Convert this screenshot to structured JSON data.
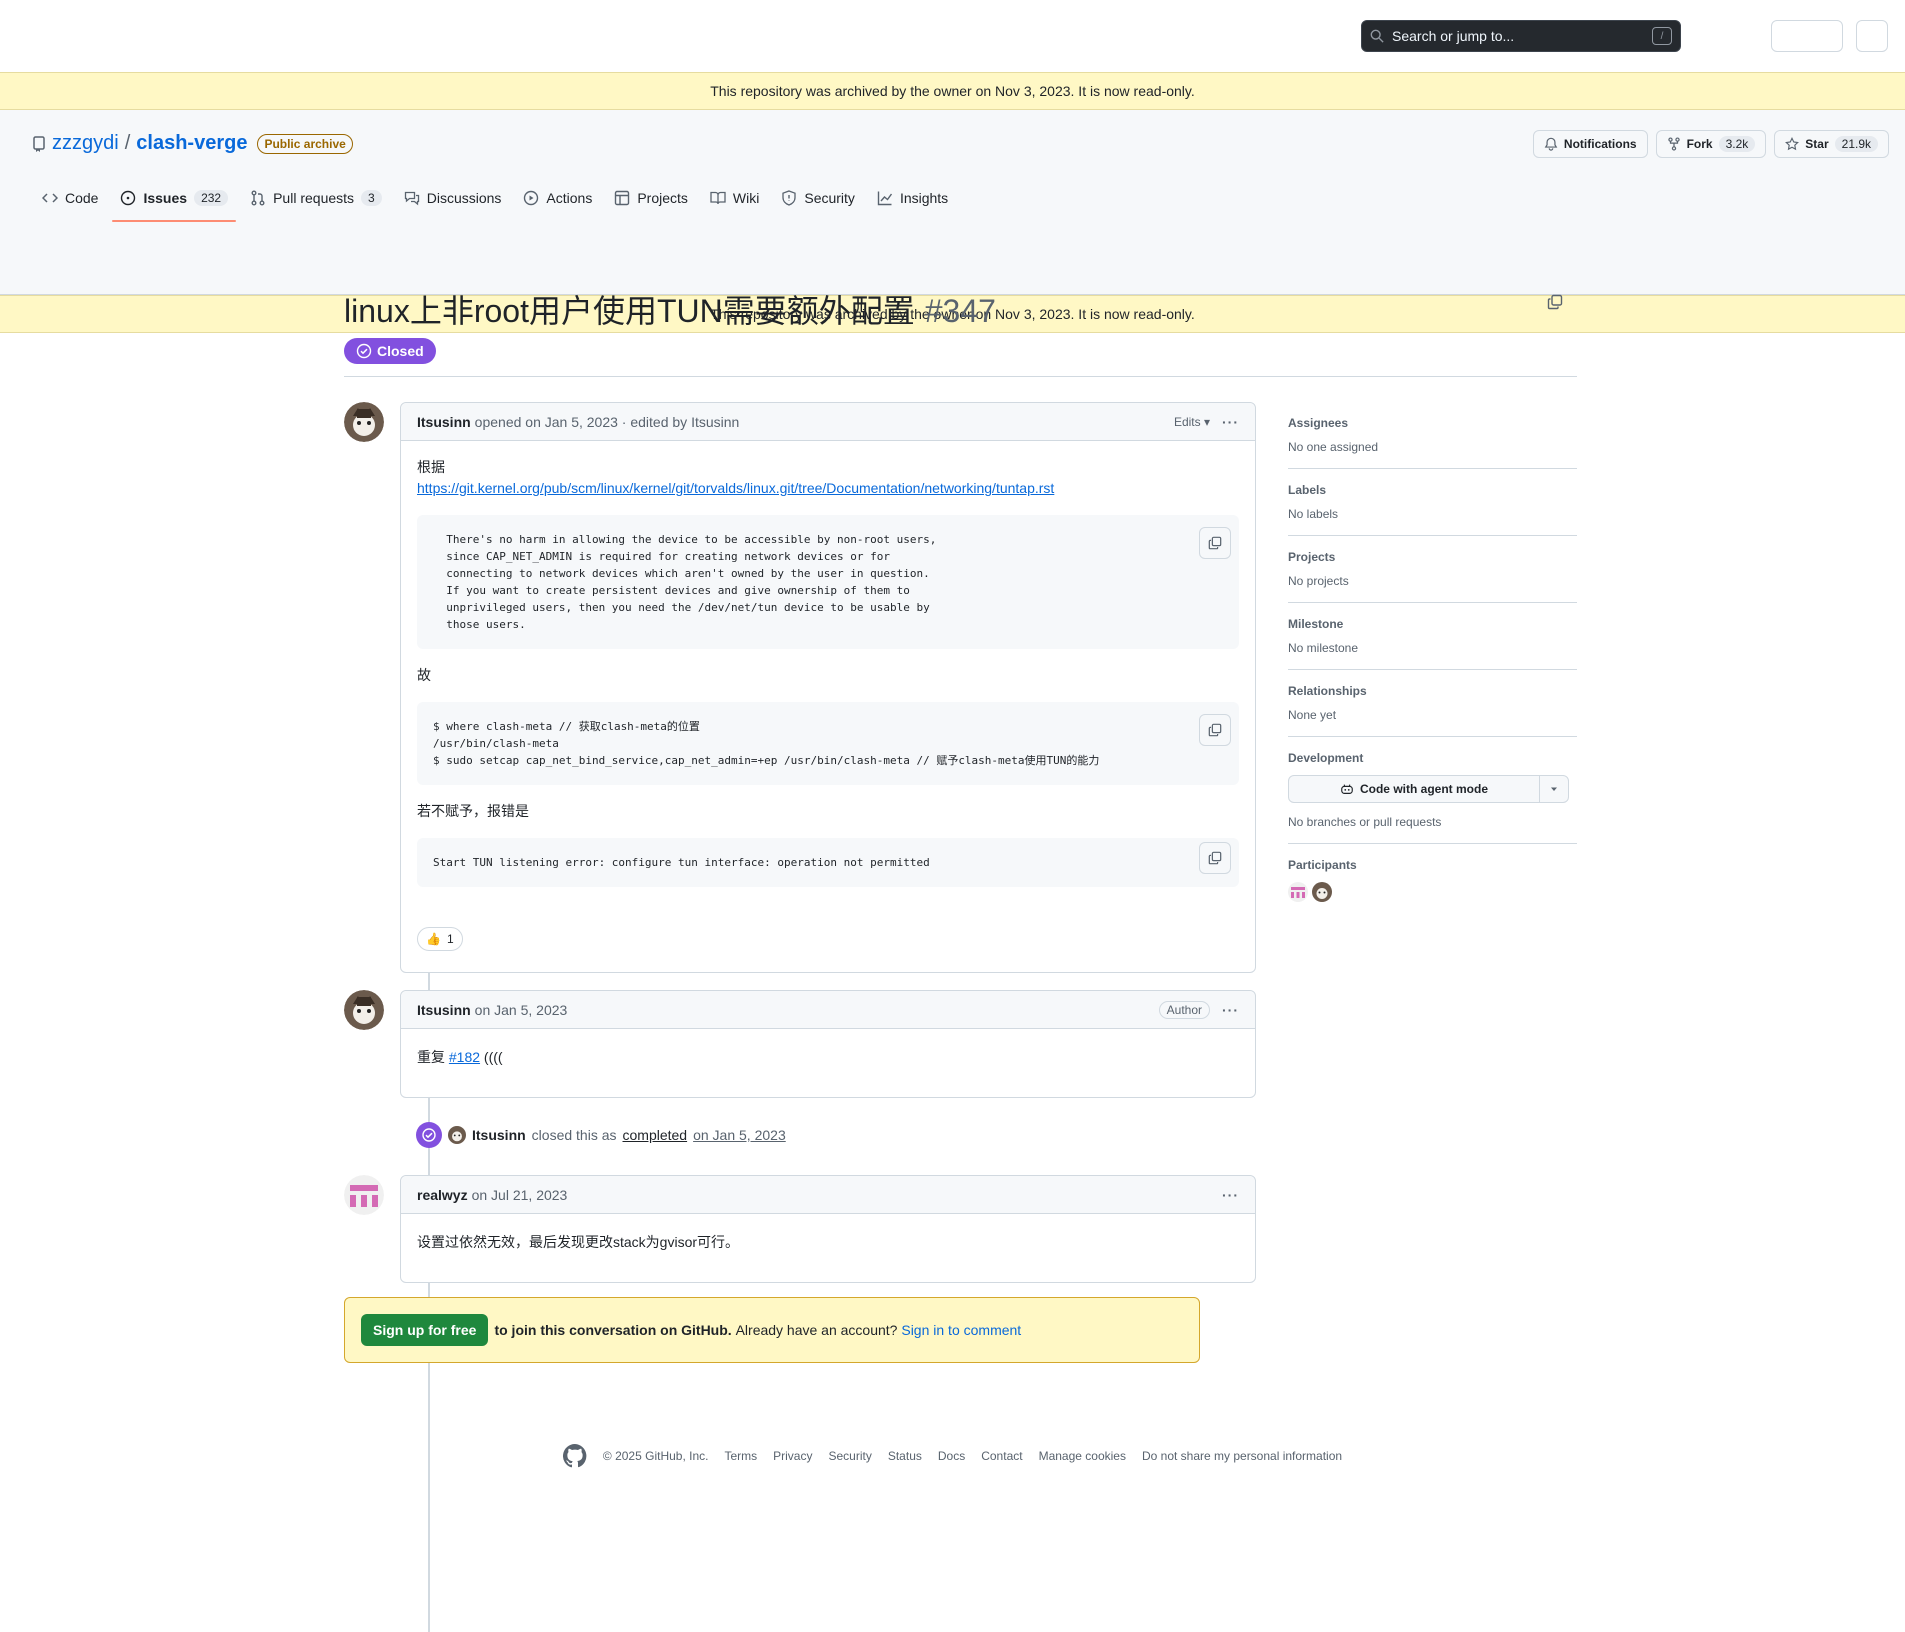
{
  "topbar": {
    "search_placeholder": "Search or jump to...",
    "search_shortcut": "/"
  },
  "archive_banner": "This repository was archived by the owner on Nov 3, 2023. It is now read-only.",
  "repo": {
    "owner": "zzzgydi",
    "sep": "/",
    "name": "clash-verge",
    "visibility": "Public archive",
    "notifications_label": "Notifications",
    "fork_label": "Fork",
    "fork_count": "3.2k",
    "star_label": "Star",
    "star_count": "21.9k"
  },
  "tabs": [
    {
      "label": "Code"
    },
    {
      "label": "Issues",
      "count": "232"
    },
    {
      "label": "Pull requests",
      "count": "3"
    },
    {
      "label": "Discussions"
    },
    {
      "label": "Actions"
    },
    {
      "label": "Projects"
    },
    {
      "label": "Wiki"
    },
    {
      "label": "Security"
    },
    {
      "label": "Insights"
    }
  ],
  "issue": {
    "title": "linux上非root用户使用TUN需要额外配置",
    "number": "#347",
    "state": "Closed"
  },
  "comments": [
    {
      "author": "Itsusinn",
      "meta": "opened on Jan 5, 2023 · edited by Itsusinn",
      "edits_label": "Edits",
      "line1": "根据",
      "link": "https://git.kernel.org/pub/scm/linux/kernel/git/torvalds/linux.git/tree/Documentation/networking/tuntap.rst",
      "code1": "  There's no harm in allowing the device to be accessible by non-root users,\n  since CAP_NET_ADMIN is required for creating network devices or for\n  connecting to network devices which aren't owned by the user in question.\n  If you want to create persistent devices and give ownership of them to\n  unprivileged users, then you need the /dev/net/tun device to be usable by\n  those users.",
      "line2": "故",
      "code2": "$ where clash-meta // 获取clash-meta的位置\n/usr/bin/clash-meta\n$ sudo setcap cap_net_bind_service,cap_net_admin=+ep /usr/bin/clash-meta // 赋予clash-meta使用TUN的能力",
      "line3": "若不赋予，报错是",
      "code3": "Start TUN listening error: configure tun interface: operation not permitted",
      "reaction_emoji": "👍",
      "reaction_count": "1"
    },
    {
      "author": "Itsusinn",
      "meta": "on Jan 5, 2023",
      "badge": "Author",
      "text_prefix": "重复 ",
      "ref": "#182",
      "text_suffix": " (((("
    },
    {
      "author": "realwyz",
      "meta": "on Jul 21, 2023",
      "text": "设置过依然无效，最后发现更改stack为gvisor可行。"
    }
  ],
  "event": {
    "actor": "Itsusinn",
    "text": "closed this as",
    "reason": "completed",
    "date": "on Jan 5, 2023"
  },
  "signup": {
    "button": "Sign up for free",
    "text_bold": "to join this conversation on GitHub.",
    "text": "Already have an account?",
    "link": "Sign in to comment"
  },
  "sidebar": {
    "assignees": {
      "title": "Assignees",
      "value": "No one assigned"
    },
    "labels": {
      "title": "Labels",
      "value": "No labels"
    },
    "projects": {
      "title": "Projects",
      "value": "No projects"
    },
    "milestone": {
      "title": "Milestone",
      "value": "No milestone"
    },
    "relationships": {
      "title": "Relationships",
      "value": "None yet"
    },
    "development": {
      "title": "Development",
      "button": "Code with agent mode",
      "value": "No branches or pull requests"
    },
    "participants": {
      "title": "Participants"
    }
  },
  "footer": {
    "copyright": "© 2025 GitHub, Inc.",
    "links": [
      "Terms",
      "Privacy",
      "Security",
      "Status",
      "Docs",
      "Contact",
      "Manage cookies",
      "Do not share my personal information"
    ]
  }
}
